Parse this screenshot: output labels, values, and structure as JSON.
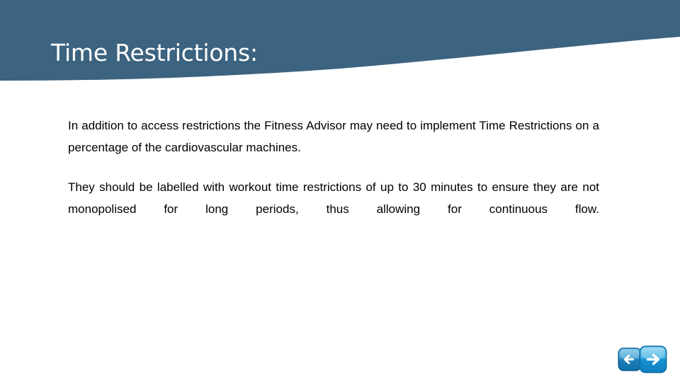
{
  "slide": {
    "title": "Time Restrictions:",
    "paragraphs": [
      "In addition to access restrictions the Fitness Advisor may need to implement Time Restrictions on a percentage of the cardiovascular machines.",
      "They should be labelled with workout time restrictions of up to 30 minutes to ensure they are not monopolised for long periods, thus allowing for continuous flow."
    ]
  },
  "navigation": {
    "previous_label": "Previous slide",
    "next_label": "Next slide",
    "previous_icon": "arrow-left-icon",
    "next_icon": "arrow-right-icon"
  },
  "colors": {
    "banner": "#3C6380",
    "banner_shadow": "#33586f",
    "title_text": "#ffffff",
    "body_text": "#000000",
    "background": "#ffffff",
    "nav_blue_light": "#5bc3ef",
    "nav_blue_dark": "#0f7fc0",
    "nav_prev_blue_light": "#54a9d6",
    "nav_prev_blue_dark": "#0d6fa8",
    "nav_arrow": "#ffffff"
  }
}
